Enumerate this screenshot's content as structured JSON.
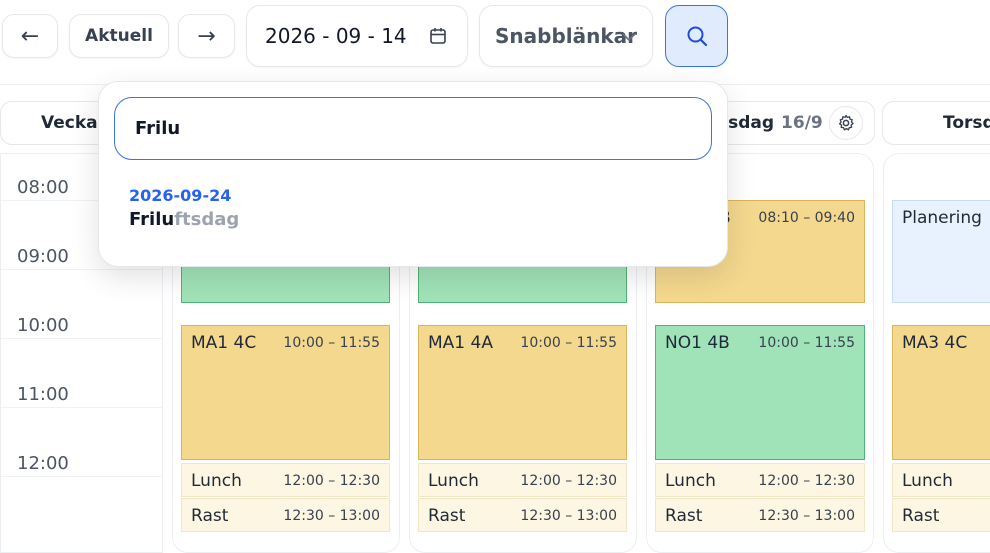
{
  "toolbar": {
    "back_label": "←",
    "current_label": "Aktuell",
    "forward_label": "→",
    "date_value": "2026 - 09 - 14",
    "quicklinks_label": "Snabblänkar"
  },
  "columns": {
    "week_label": "Vecka",
    "col3_day": "nsdag",
    "col3_date": "16/9",
    "col4_day": "Torsd"
  },
  "times": [
    "08:00",
    "09:00",
    "10:00",
    "11:00",
    "12:00"
  ],
  "events": {
    "c1_ma": {
      "name": "MA1 4C",
      "time": "10:00 – 11:55"
    },
    "c1_lunch": {
      "name": "Lunch",
      "time": "12:00 – 12:30"
    },
    "c1_rast": {
      "name": "Rast",
      "time": "12:30 – 13:00"
    },
    "c2_ma": {
      "name": "MA1 4A",
      "time": "10:00 – 11:55"
    },
    "c2_lunch": {
      "name": "Lunch",
      "time": "12:00 – 12:30"
    },
    "c2_rast": {
      "name": "Rast",
      "time": "12:30 – 13:00"
    },
    "c3_top": {
      "name": "B",
      "time": "08:10 – 09:40"
    },
    "c3_no": {
      "name": "NO1 4B",
      "time": "10:00 – 11:55"
    },
    "c3_lunch": {
      "name": "Lunch",
      "time": "12:00 – 12:30"
    },
    "c3_rast": {
      "name": "Rast",
      "time": "12:30 – 13:00"
    },
    "c4_plan": {
      "name": "Planering"
    },
    "c4_ma": {
      "name": "MA3 4C"
    },
    "c4_lunch": {
      "name": "Lunch"
    },
    "c4_rast": {
      "name": "Rast"
    }
  },
  "search": {
    "value": "Frilu",
    "result_date": "2026-09-24",
    "result_match": "Frilu",
    "result_rest": "ftsdag"
  },
  "colors": {
    "accent": "#3b74e0",
    "event_yellow": "#f4d88e",
    "event_green": "#a1e3b8",
    "event_blue": "#e8f1fe"
  }
}
